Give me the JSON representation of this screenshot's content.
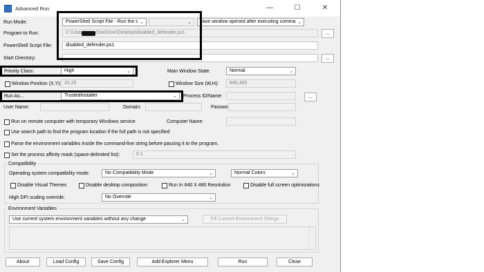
{
  "window": {
    "title": "Advanced Run",
    "minimize": "—",
    "maximize": "☐",
    "close": "✕"
  },
  "run_mode": {
    "label": "Run Mode:",
    "value": "PowerShell Script File - Run the specif",
    "leave_open_value": "eave window opened after executing comma"
  },
  "program_to_run": {
    "label": "Program to Run:",
    "value_prefix": "C:\\Users\\",
    "value_suffix": "OneDrive\\Desktop\\disabled_defender.ps1",
    "browse": "..."
  },
  "ps_script_file": {
    "label": "PowerShell Script File:",
    "value": "disabled_defender.ps1"
  },
  "start_directory": {
    "label": "Start Directory:",
    "browse": "..."
  },
  "priority_class": {
    "label": "Priority Class:",
    "value": "High"
  },
  "main_window_state": {
    "label": "Main Window State:",
    "value": "Normal"
  },
  "window_position": {
    "label": "Window Position (X,Y):",
    "value": "20,20"
  },
  "window_size": {
    "label": "Window Size (W,H):",
    "value": "640,400"
  },
  "run_as": {
    "label": "Run As...",
    "value": "TrustedInstaller",
    "process_label": "Process ID/Name:",
    "browse": "..."
  },
  "credentials": {
    "user_name": "User Name:",
    "domain": "Domain:",
    "password": "Password:"
  },
  "options": {
    "remote": "Run on remote computer with temporary Windows service",
    "computer_name": "Computer Name:",
    "search_path": "Use search path to find the program location if the full path is not specified",
    "parse_env": "Parse the environment variables inside the command-line string before passing it to the program.",
    "affinity": "Set the process affinity mask (space-delimited list):",
    "affinity_value": "0 1"
  },
  "compatibility": {
    "group_title": "Compatibility",
    "os_mode_label": "Operating system compatibility mode:",
    "os_mode_value": "No Compatibility Mode",
    "colors_value": "Normal Colors",
    "disable_themes": "Disable Visual Themes",
    "disable_composition": "Disable desktop composition",
    "run_640": "Run In 640 X 480 Resolution",
    "disable_fullscreen": "Disable full screen optimizations",
    "dpi_label": "High DPI scaling override:",
    "dpi_value": "No Override"
  },
  "environment": {
    "group_title": "Environment Variables",
    "value": "Use current system environment variables without any change",
    "fill_button": "Fill Current Environment Strings"
  },
  "buttons": {
    "about": "About",
    "load_config": "Load Config",
    "save_config": "Save Config",
    "add_explorer_menu": "Add Explorer Menu",
    "run": "Run",
    "close": "Close"
  }
}
